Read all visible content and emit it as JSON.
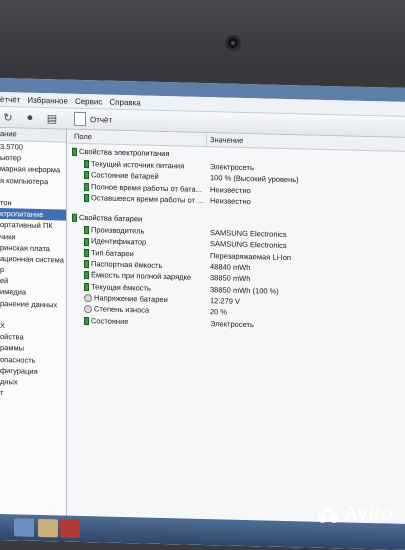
{
  "menu": [
    "ётчёт",
    "Избранное",
    "Сервис",
    "Справка"
  ],
  "toolbar": {
    "report_label": "Отчёт"
  },
  "left_panel": {
    "header": "ание",
    "items": [
      "3.5700",
      "ьютер",
      "марная информа",
      "я компьютера",
      "",
      "тон",
      "ктропитание",
      "ортативный ПК",
      "чики",
      "ринская плата",
      "ационная система",
      "р",
      "ей",
      "имедиа",
      "ранение данных",
      "",
      "Х",
      "ойства",
      "раммы",
      "опасность",
      "фигурация",
      "дных",
      "т"
    ],
    "selected_index": 6
  },
  "columns": {
    "field": "Поле",
    "value": "Значение"
  },
  "power_section": {
    "title": "Свойства электропитания",
    "rows": [
      {
        "field": "Текущий источник питания",
        "value": "Электросеть"
      },
      {
        "field": "Состояние батарей",
        "value": "100 % (Высокий уровень)"
      },
      {
        "field": "Полное время работы от бата...",
        "value": "Неизвестно"
      },
      {
        "field": "Оставшееся время работы от ...",
        "value": "Неизвестно"
      }
    ]
  },
  "battery_section": {
    "title": "Свойства батареи",
    "rows": [
      {
        "field": "Производитель",
        "value": "SAMSUNG Electronics",
        "icon": "battery-icon"
      },
      {
        "field": "Идентификатор",
        "value": "SAMSUNG Electronics",
        "icon": "battery-icon"
      },
      {
        "field": "Тип батареи",
        "value": "Перезаряжаемая Li-Ion",
        "icon": "battery-icon"
      },
      {
        "field": "Паспортная ёмкость",
        "value": "48840 mWh",
        "icon": "battery-icon"
      },
      {
        "field": "Ёмкость при полной зарядке",
        "value": "38850 mWh",
        "icon": "battery-icon"
      },
      {
        "field": "Текущая ёмкость",
        "value": "38850 mWh  (100 %)",
        "icon": "battery-icon"
      },
      {
        "field": "Напряжение батареи",
        "value": "12.279 V",
        "icon": "gauge-icon"
      },
      {
        "field": "Степень износа",
        "value": "20 %",
        "icon": "gauge-icon"
      },
      {
        "field": "Состояние",
        "value": "Электросеть",
        "icon": "battery-icon"
      }
    ]
  },
  "watermark": {
    "text": "Avito"
  },
  "colors": {
    "selection": "#3d6fb6",
    "battery_green": "#3a9b3a",
    "taskbar": "#3f5a80"
  }
}
